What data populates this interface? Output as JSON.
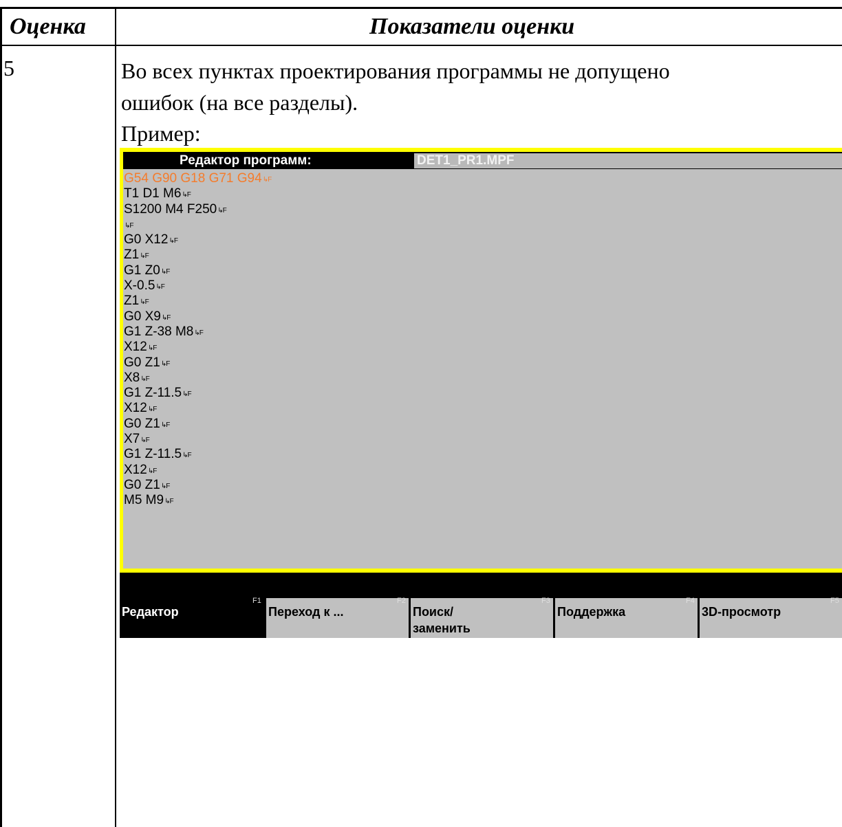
{
  "table": {
    "header": {
      "col1": "Оценка",
      "col2": "Показатели оценки"
    },
    "row": {
      "grade": "5",
      "text_line1": "Во всех пунктах проектирования программы не допущено",
      "text_line2": "ошибок (на все разделы).",
      "example_label": "Пример:"
    }
  },
  "cnc_editor": {
    "title_label": "Редактор программ:",
    "filename": "DET1_PR1.MPF",
    "line_end_symbol": "↳F",
    "colors": {
      "frame": "#ffff00",
      "background": "#c0c0c0",
      "highlight": "#f47c2c"
    },
    "code_lines": [
      {
        "text": "G54 G90 G18 G71 G94",
        "highlight": true
      },
      {
        "text": "T1 D1 M6",
        "highlight": false
      },
      {
        "text": "S1200 M4 F250",
        "highlight": false
      },
      {
        "text": "",
        "highlight": false
      },
      {
        "text": "G0 X12",
        "highlight": false
      },
      {
        "text": "Z1",
        "highlight": false
      },
      {
        "text": "G1 Z0",
        "highlight": false
      },
      {
        "text": "X-0.5",
        "highlight": false
      },
      {
        "text": "Z1",
        "highlight": false
      },
      {
        "text": "G0 X9",
        "highlight": false
      },
      {
        "text": "G1 Z-38 M8",
        "highlight": false
      },
      {
        "text": "X12",
        "highlight": false
      },
      {
        "text": "G0 Z1",
        "highlight": false
      },
      {
        "text": "X8",
        "highlight": false
      },
      {
        "text": "G1 Z-11.5",
        "highlight": false
      },
      {
        "text": "X12",
        "highlight": false
      },
      {
        "text": "G0 Z1",
        "highlight": false
      },
      {
        "text": "X7",
        "highlight": false
      },
      {
        "text": "G1 Z-11.5",
        "highlight": false
      },
      {
        "text": "X12",
        "highlight": false
      },
      {
        "text": "G0 Z1",
        "highlight": false
      },
      {
        "text": "M5 M9",
        "highlight": false
      }
    ],
    "softkeys": [
      {
        "label": "Редактор",
        "fkey": "F1",
        "active": true
      },
      {
        "label": "Переход к ...",
        "fkey": "F2",
        "active": false
      },
      {
        "label": "Поиск/\nзаменить",
        "fkey": "F3",
        "active": false
      },
      {
        "label": "Поддержка",
        "fkey": "F4",
        "active": false
      },
      {
        "label": "3D-просмотр",
        "fkey": "F5",
        "active": false
      }
    ]
  }
}
